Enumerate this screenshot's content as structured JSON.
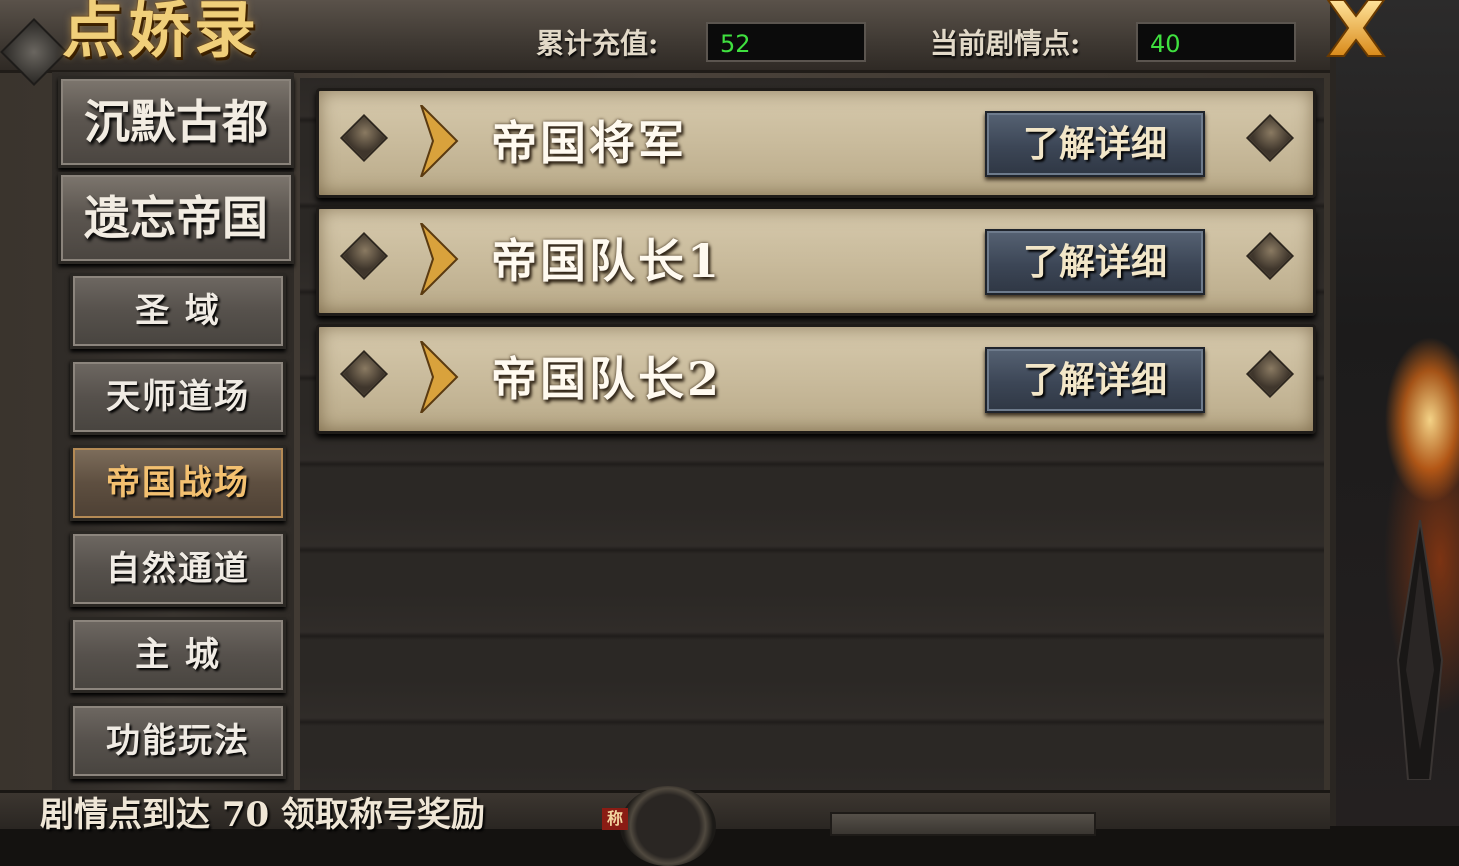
{
  "window": {
    "title": "点娇录"
  },
  "header": {
    "recharge_label": "累计充值:",
    "recharge_value": "52",
    "plot_label": "当前剧情点:",
    "plot_value": "40"
  },
  "sidebar": {
    "big_tabs": [
      {
        "label": "沉默古都"
      },
      {
        "label": "遗忘帝国"
      }
    ],
    "small_tabs": [
      {
        "label": "圣  域"
      },
      {
        "label": "天师道场"
      },
      {
        "label": "帝国战场",
        "active": true
      },
      {
        "label": "自然通道"
      },
      {
        "label": "主  城"
      },
      {
        "label": "功能玩法"
      }
    ]
  },
  "list": {
    "rows": [
      {
        "name": "帝国将军",
        "button": "了解详细"
      },
      {
        "name": "帝国队长1",
        "button": "了解详细"
      },
      {
        "name": "帝国队长2",
        "button": "了解详细"
      }
    ]
  },
  "footer": {
    "text": "剧情点到达 70 领取称号奖励",
    "badge": "称"
  },
  "icons": {
    "close": "close-x-icon",
    "arrow": "gold-arrow-icon",
    "stud": "diamond-stud-icon"
  },
  "colors": {
    "value_text": "#3fe03f",
    "active_tab_text": "#f3c070",
    "title_gold": "#f0cf7a"
  }
}
